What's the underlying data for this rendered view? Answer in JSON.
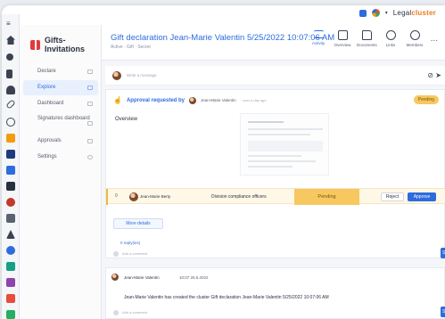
{
  "brand": {
    "name_prefix": "Legal",
    "name_suffix": "cluster"
  },
  "module": {
    "title": "Gifts-Invitations"
  },
  "nav": [
    {
      "label": "Declare"
    },
    {
      "label": "Explore"
    },
    {
      "label": "Dashboard"
    },
    {
      "label": "Signatures dashboard"
    },
    {
      "label": "Approvals"
    },
    {
      "label": "Settings"
    }
  ],
  "header": {
    "title": "Gift declaration Jean-Marie Valentin 5/25/2022 10:07:06 AM",
    "subtitle": "Active  ·  Gift  ·  Secret",
    "tabs": [
      {
        "label": "Activity"
      },
      {
        "label": "Overview"
      },
      {
        "label": "Documents"
      },
      {
        "label": "Links"
      },
      {
        "label": "Members"
      }
    ],
    "more": "..."
  },
  "composer": {
    "placeholder": "Write a message"
  },
  "approval": {
    "title": "Approval requested by",
    "requester": "Jean-Marie Valentin",
    "time": "· over a day ago",
    "status": "Pending",
    "overview_label": "Overview",
    "row": {
      "step": "0",
      "approver": "Jean-Marie Berty",
      "role": "Division compliance officers",
      "status": "Pending",
      "reject": "Reject",
      "approve": "Approve"
    },
    "more_details": "More details",
    "replies": "0 reply(ies)",
    "comment_placeholder": "Add a comment"
  },
  "event": {
    "author": "Jean-Marie Valentin",
    "time": "10:07 25.5.2022",
    "text": "Jean-Marie Valentin has created the cluster Gift declaration Jean-Marie Valentin 5/25/2022 10:07:06 AM",
    "comment_placeholder": "Add a comment"
  },
  "send_label": "Se",
  "colors": {
    "accent": "#2d6cdf",
    "pending": "#f6c85f",
    "gift": "#e23b3b"
  }
}
